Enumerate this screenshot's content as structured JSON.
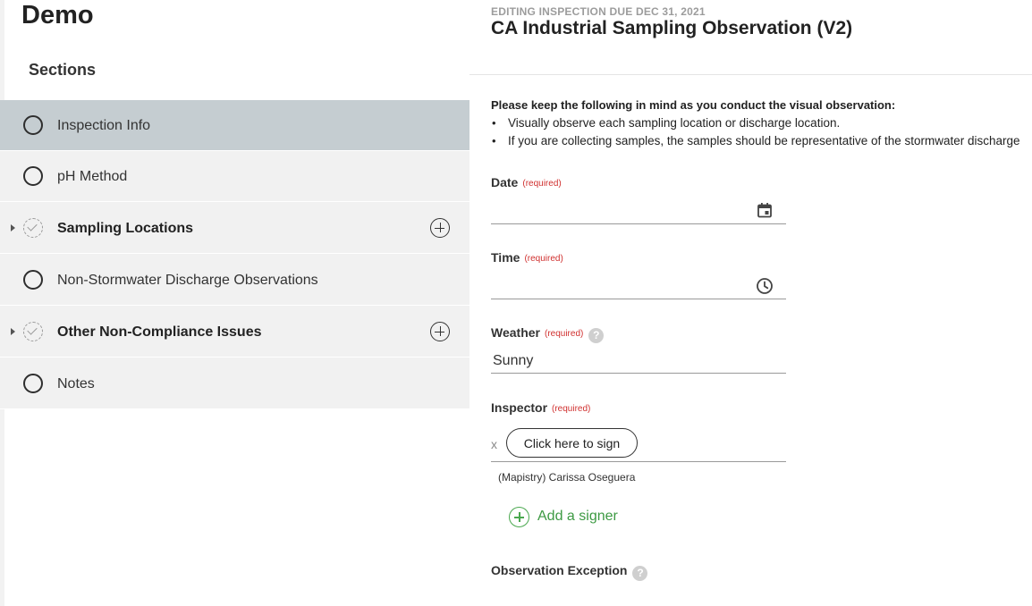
{
  "app": {
    "title": "Demo"
  },
  "sidebar": {
    "heading": "Sections",
    "items": [
      {
        "label": "Inspection Info",
        "status": "incomplete",
        "active": true,
        "expandable": false,
        "addable": false
      },
      {
        "label": "pH Method",
        "status": "incomplete",
        "active": false,
        "expandable": false,
        "addable": false
      },
      {
        "label": "Sampling Locations",
        "status": "group",
        "active": false,
        "expandable": true,
        "addable": true
      },
      {
        "label": "Non-Stormwater Discharge Observations",
        "status": "incomplete",
        "active": false,
        "expandable": false,
        "addable": false
      },
      {
        "label": "Other Non-Compliance Issues",
        "status": "group",
        "active": false,
        "expandable": true,
        "addable": true
      },
      {
        "label": "Notes",
        "status": "incomplete",
        "active": false,
        "expandable": false,
        "addable": false
      }
    ]
  },
  "header": {
    "eyebrow": "EDITING INSPECTION DUE DEC 31, 2021",
    "title": "CA Industrial Sampling Observation (V2)"
  },
  "intro": {
    "heading": "Please keep the following in mind as you conduct the visual observation:",
    "bullets": [
      "Visually observe each sampling location or discharge location.",
      "If you are collecting samples, the samples should be representative of the stormwater discharge"
    ]
  },
  "form": {
    "required_text": "(required)",
    "help_glyph": "?",
    "date": {
      "label": "Date",
      "value": "",
      "icon": "calendar-icon"
    },
    "time": {
      "label": "Time",
      "value": "",
      "icon": "clock-icon"
    },
    "weather": {
      "label": "Weather",
      "value": "Sunny"
    },
    "inspector": {
      "label": "Inspector",
      "x_mark": "x",
      "sign_button": "Click here to sign",
      "signer_name": "(Mapistry) Carissa Oseguera",
      "add_signer": "Add a signer"
    },
    "observation_exception": {
      "label": "Observation Exception"
    }
  },
  "colors": {
    "active_section": "#c5cdd1",
    "section_bg": "#f1f1f1",
    "required": "#d0302f",
    "accent_green": "#3d9a43"
  }
}
